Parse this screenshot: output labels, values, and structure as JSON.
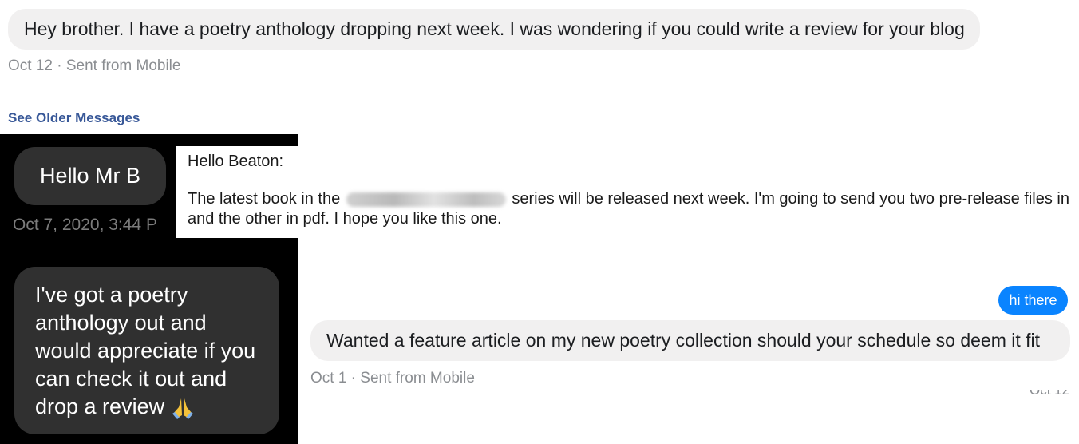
{
  "top": {
    "message": "Hey brother. I have a poetry anthology dropping next week. I was wondering if you could write a review for your blog",
    "meta": "Oct 12 · Sent from Mobile",
    "see_older": "See Older Messages"
  },
  "dark_chat": {
    "greeting": "Hello Mr B",
    "timestamp": "Oct 7, 2020, 3:44 P",
    "message": "I've got a poetry anthology out and would appreciate if you can check it out and drop a review",
    "emoji_icon": "folded-hands-icon"
  },
  "email": {
    "salutation": "Hello Beaton:",
    "text_before": "The latest book in the",
    "text_after": "series will be released next week. I'm going to send you two pre-release files in",
    "text_line2": "and the other in pdf. I hope you like this one."
  },
  "bottom": {
    "sent_bubble": "hi there",
    "message": "Wanted a feature article on my new poetry collection should your schedule so deem it fit",
    "meta": "Oct 1 · Sent from Mobile",
    "cut_meta": "Oct 12"
  },
  "colors": {
    "link": "#385898",
    "sent_blue": "#0a84ff",
    "dark_bubble": "#303030"
  }
}
